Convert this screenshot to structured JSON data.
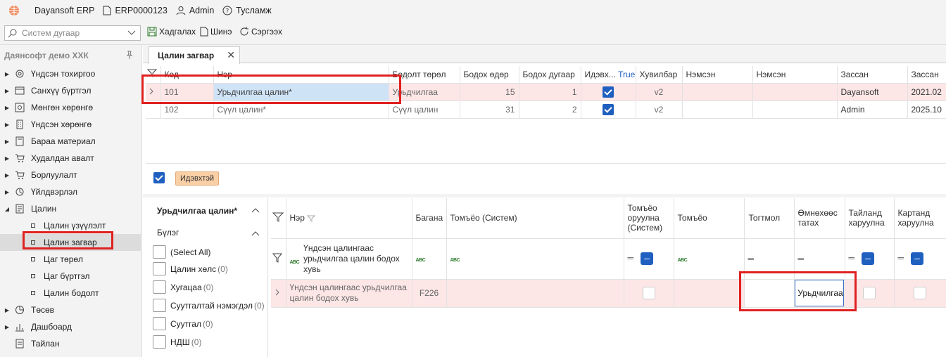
{
  "titlebar": {
    "app_name": "Dayansoft ERP",
    "doc_number": "ERP0000123",
    "user": "Admin",
    "help": "Тусламж"
  },
  "toolbar": {
    "search_placeholder": "Систем дугаар",
    "save_label": "Хадгалах",
    "new_label": "Шинэ",
    "refresh_label": "Сэргээх"
  },
  "sidebar": {
    "company": "Даянсофт демо ХХК",
    "items": [
      {
        "label": "Үндсэн тохиргоо",
        "icon": "gear-icon"
      },
      {
        "label": "Санхүү бүртгэл",
        "icon": "ledger-icon"
      },
      {
        "label": "Мөнгөн хөрөнгө",
        "icon": "cash-icon"
      },
      {
        "label": "Үндсэн хөрөнгө",
        "icon": "building-icon"
      },
      {
        "label": "Бараа материал",
        "icon": "box-icon"
      },
      {
        "label": "Худалдан авалт",
        "icon": "cart-icon"
      },
      {
        "label": "Борлуулалт",
        "icon": "cart-icon"
      },
      {
        "label": "Үйлдвэрлэл",
        "icon": "factory-icon"
      },
      {
        "label": "Цалин",
        "icon": "salary-icon"
      }
    ],
    "subitems": [
      {
        "label": "Цалин үзүүлэлт"
      },
      {
        "label": "Цалин загвар"
      },
      {
        "label": "Цаг төрөл"
      },
      {
        "label": "Цаг бүртгэл"
      },
      {
        "label": "Цалин бодолт"
      }
    ],
    "after_items": [
      {
        "label": "Төсөв",
        "icon": "pie-icon"
      },
      {
        "label": "Дашбоард",
        "icon": "chart-icon"
      },
      {
        "label": "Тайлан",
        "icon": "report-icon"
      }
    ]
  },
  "tab": {
    "label": "Цалин загвар"
  },
  "grid1": {
    "columns": [
      "Код",
      "Нэр",
      "Бодолт төрөл",
      "Бодох өдөр",
      "Бодох дугаар",
      "Идэвх...",
      "True",
      "Хувилбар",
      "Нэмсэн",
      "Нэмсэн",
      "Зассан",
      "Зассан"
    ],
    "rows": [
      {
        "code": "101",
        "name": "Урьдчилгаа цалин*",
        "type": "Урьдчилгаа",
        "day": "15",
        "number": "1",
        "version": "v2",
        "added1": "",
        "added2": "",
        "editor": "Dayansoft",
        "edited": "2021.02"
      },
      {
        "code": "102",
        "name": "Сүүл цалин*",
        "type": "Сүүл цалин",
        "day": "31",
        "number": "2",
        "version": "v2",
        "added1": "",
        "added2": "",
        "editor": "Admin",
        "edited": "2025.10"
      }
    ]
  },
  "filter_badge": "Идэвхтэй",
  "left_panel": {
    "title": "Урьдчилгаа цалин*",
    "group": "Бүлэг",
    "options": [
      {
        "label": "(Select All)",
        "count": ""
      },
      {
        "label": "Цалин хөлс",
        "count": "(0)"
      },
      {
        "label": "Хугацаа",
        "count": "(0)"
      },
      {
        "label": "Суутгалтай нэмэгдэл",
        "count": "(0)"
      },
      {
        "label": "Суутгал",
        "count": "(0)"
      },
      {
        "label": "НДШ",
        "count": "(0)"
      }
    ]
  },
  "grid2": {
    "columns": [
      "Нэр",
      "Багана",
      "Томъёо (Систем)",
      "Томъёо оруулна (Систем)",
      "Томъёо",
      "Тогтмол",
      "Өмнөхөөс татах",
      "Тайланд харуулна",
      "Картанд харуулна"
    ],
    "filter_name": "Үндсэн цалингаас урьдчилгаа цалин бодох хувь",
    "filter_abc": "ABC",
    "eq": "═",
    "minus": "–",
    "row": {
      "name": "Үндсэн цалингаас урьдчилгаа цалин бодох хувь",
      "column": "F226",
      "pull_value": "Урьдчилгаа"
    }
  }
}
